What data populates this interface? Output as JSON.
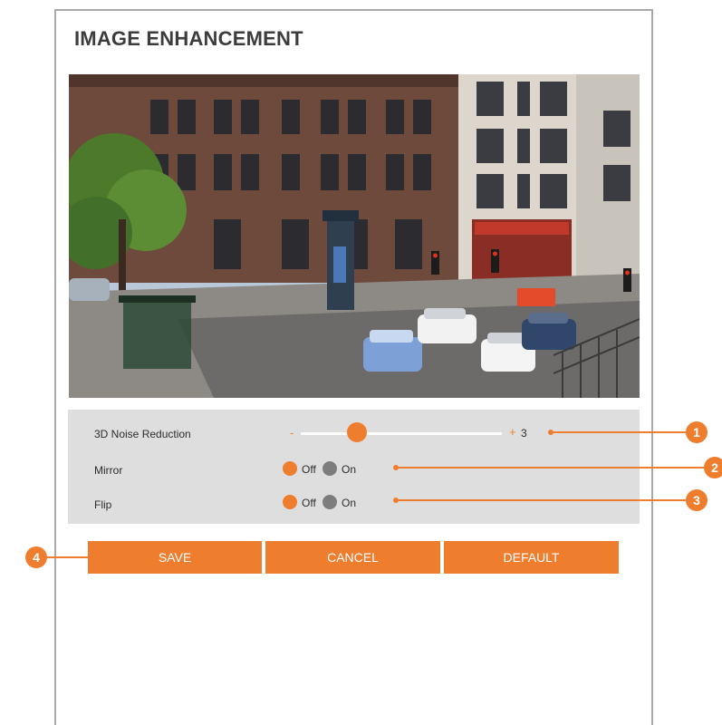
{
  "page": {
    "title": "IMAGE ENHANCEMENT"
  },
  "preview": {
    "description_icon": "camera-live-view"
  },
  "settings": {
    "noise_reduction": {
      "label": "3D Noise Reduction",
      "minus": "-",
      "plus": "+",
      "value": "3",
      "level_fraction": 0.27
    },
    "mirror": {
      "label": "Mirror",
      "options": [
        "Off",
        "On"
      ],
      "selected": "Off"
    },
    "flip": {
      "label": "Flip",
      "options": [
        "Off",
        "On"
      ],
      "selected": "Off"
    }
  },
  "buttons": {
    "save": "SAVE",
    "cancel": "CANCEL",
    "default": "DEFAULT"
  },
  "callouts": [
    "1",
    "2",
    "3",
    "4"
  ],
  "colors": {
    "accent": "#ee7d2e",
    "panel_bg": "#dedede",
    "radio_off": "#7d7d7d"
  }
}
